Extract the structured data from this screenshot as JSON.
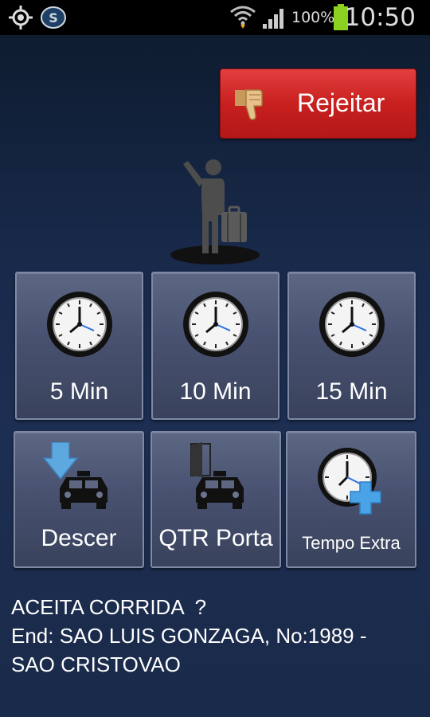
{
  "status_bar": {
    "battery_percent": "100%",
    "time": "10:50",
    "icons": [
      "gps-icon",
      "app-notification-icon",
      "wifi-icon",
      "signal-icon",
      "battery-icon"
    ]
  },
  "reject_button": {
    "label": "Rejeitar",
    "icon": "thumbs-down-icon",
    "color": "#d42c2b"
  },
  "passenger_icon": "hailing-passenger-icon",
  "time_buttons": [
    {
      "label": "5 Min",
      "icon": "clock-icon"
    },
    {
      "label": "10 Min",
      "icon": "clock-icon"
    },
    {
      "label": "15 Min",
      "icon": "clock-icon"
    }
  ],
  "action_buttons": [
    {
      "label": "Descer",
      "icon": "taxi-drop-off-icon"
    },
    {
      "label": "QTR Porta",
      "icon": "taxi-door-icon"
    },
    {
      "label": "Tempo Extra",
      "icon": "clock-plus-icon"
    }
  ],
  "message": {
    "line1": "ACEITA CORRIDA  ?",
    "line2": "End: SAO LUIS GONZAGA, No:1989 -",
    "line3": "SAO CRISTOVAO"
  }
}
